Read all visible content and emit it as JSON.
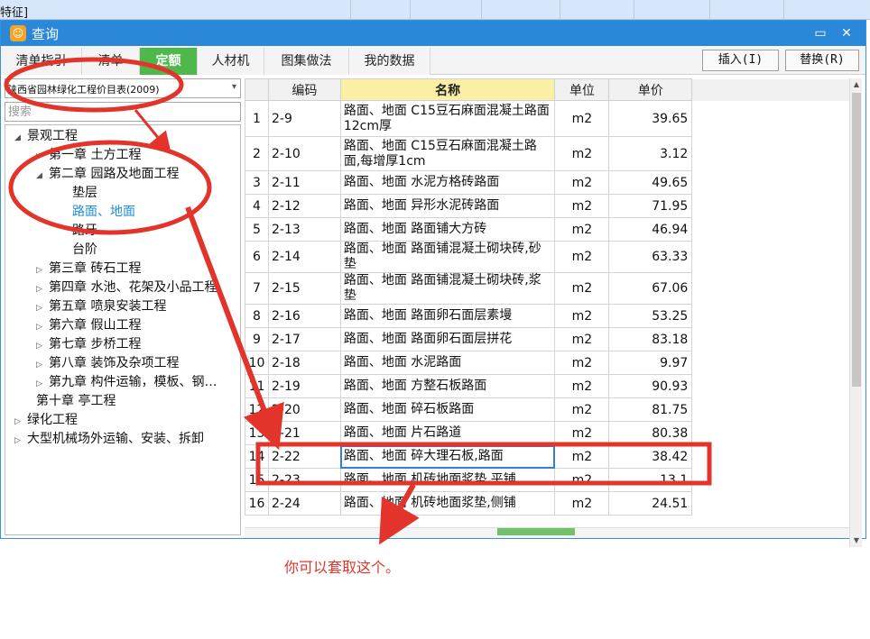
{
  "background": {
    "cell_text": "特征]"
  },
  "window": {
    "title": "查询"
  },
  "tabs": [
    {
      "label": "清单指引"
    },
    {
      "label": "清单"
    },
    {
      "label": "定额"
    },
    {
      "label": "人材机"
    },
    {
      "label": "图集做法"
    },
    {
      "label": "我的数据"
    }
  ],
  "actions": {
    "insert": "插入(I)",
    "replace": "替换(R)"
  },
  "sidebar": {
    "library": "陕西省园林绿化工程价目表(2009)",
    "search_placeholder": "搜索",
    "tree": [
      {
        "label": "景观工程",
        "level": 0,
        "state": "expanded"
      },
      {
        "label": "第一章 土方工程",
        "level": 1,
        "state": "collapsed"
      },
      {
        "label": "第二章 园路及地面工程",
        "level": 1,
        "state": "expanded"
      },
      {
        "label": "垫层",
        "level": 2,
        "state": "leaf"
      },
      {
        "label": "路面、地面",
        "level": 2,
        "state": "leaf",
        "selected": true
      },
      {
        "label": "路牙",
        "level": 2,
        "state": "leaf"
      },
      {
        "label": "台阶",
        "level": 2,
        "state": "leaf"
      },
      {
        "label": "第三章 砖石工程",
        "level": 1,
        "state": "collapsed"
      },
      {
        "label": "第四章 水池、花架及小品工程",
        "level": 1,
        "state": "collapsed"
      },
      {
        "label": "第五章 喷泉安装工程",
        "level": 1,
        "state": "collapsed"
      },
      {
        "label": "第六章 假山工程",
        "level": 1,
        "state": "collapsed"
      },
      {
        "label": "第七章 步桥工程",
        "level": 1,
        "state": "collapsed"
      },
      {
        "label": "第八章 装饰及杂项工程",
        "level": 1,
        "state": "collapsed"
      },
      {
        "label": "第九章 构件运输，模板、钢…",
        "level": 1,
        "state": "collapsed"
      },
      {
        "label": "第十章 亭工程",
        "level": 1,
        "state": "leaf"
      },
      {
        "label": "绿化工程",
        "level": 0,
        "state": "collapsed"
      },
      {
        "label": "大型机械场外运输、安装、拆卸",
        "level": 0,
        "state": "collapsed"
      }
    ]
  },
  "grid": {
    "columns": [
      "编码",
      "名称",
      "单位",
      "单价"
    ],
    "rows": [
      {
        "no": "1",
        "code": "2-9",
        "name": "路面、地面 C15豆石麻面混凝土路面12cm厚",
        "unit": "m2",
        "price": "39.65"
      },
      {
        "no": "2",
        "code": "2-10",
        "name": "路面、地面 C15豆石麻面混凝土路面,每增厚1cm",
        "unit": "m2",
        "price": "3.12"
      },
      {
        "no": "3",
        "code": "2-11",
        "name": "路面、地面 水泥方格砖路面",
        "unit": "m2",
        "price": "49.65"
      },
      {
        "no": "4",
        "code": "2-12",
        "name": "路面、地面 异形水泥砖路面",
        "unit": "m2",
        "price": "71.95"
      },
      {
        "no": "5",
        "code": "2-13",
        "name": "路面、地面 路面铺大方砖",
        "unit": "m2",
        "price": "46.94"
      },
      {
        "no": "6",
        "code": "2-14",
        "name": "路面、地面 路面铺混凝土砌块砖,砂垫",
        "unit": "m2",
        "price": "63.33"
      },
      {
        "no": "7",
        "code": "2-15",
        "name": "路面、地面 路面铺混凝土砌块砖,浆垫",
        "unit": "m2",
        "price": "67.06"
      },
      {
        "no": "8",
        "code": "2-16",
        "name": "路面、地面 路面卵石面层素墁",
        "unit": "m2",
        "price": "53.25"
      },
      {
        "no": "9",
        "code": "2-17",
        "name": "路面、地面 路面卵石面层拼花",
        "unit": "m2",
        "price": "83.18"
      },
      {
        "no": "10",
        "code": "2-18",
        "name": "路面、地面 水泥路面",
        "unit": "m2",
        "price": "9.97"
      },
      {
        "no": "11",
        "code": "2-19",
        "name": "路面、地面 方整石板路面",
        "unit": "m2",
        "price": "90.93"
      },
      {
        "no": "12",
        "code": "2-20",
        "name": "路面、地面 碎石板路面",
        "unit": "m2",
        "price": "81.75"
      },
      {
        "no": "13",
        "code": "2-21",
        "name": "路面、地面 片石路道",
        "unit": "m2",
        "price": "80.38"
      },
      {
        "no": "14",
        "code": "2-22",
        "name": "路面、地面 碎大理石板,路面",
        "unit": "m2",
        "price": "38.42"
      },
      {
        "no": "15",
        "code": "2-23",
        "name": "路面、地面 机砖地面浆垫,平铺",
        "unit": "m2",
        "price": "13.1"
      },
      {
        "no": "16",
        "code": "2-24",
        "name": "路面、地面 机砖地面浆垫,侧铺",
        "unit": "m2",
        "price": "24.51"
      }
    ]
  },
  "annotation": {
    "note": "你可以套取这个。",
    "color": "#e2342b"
  }
}
